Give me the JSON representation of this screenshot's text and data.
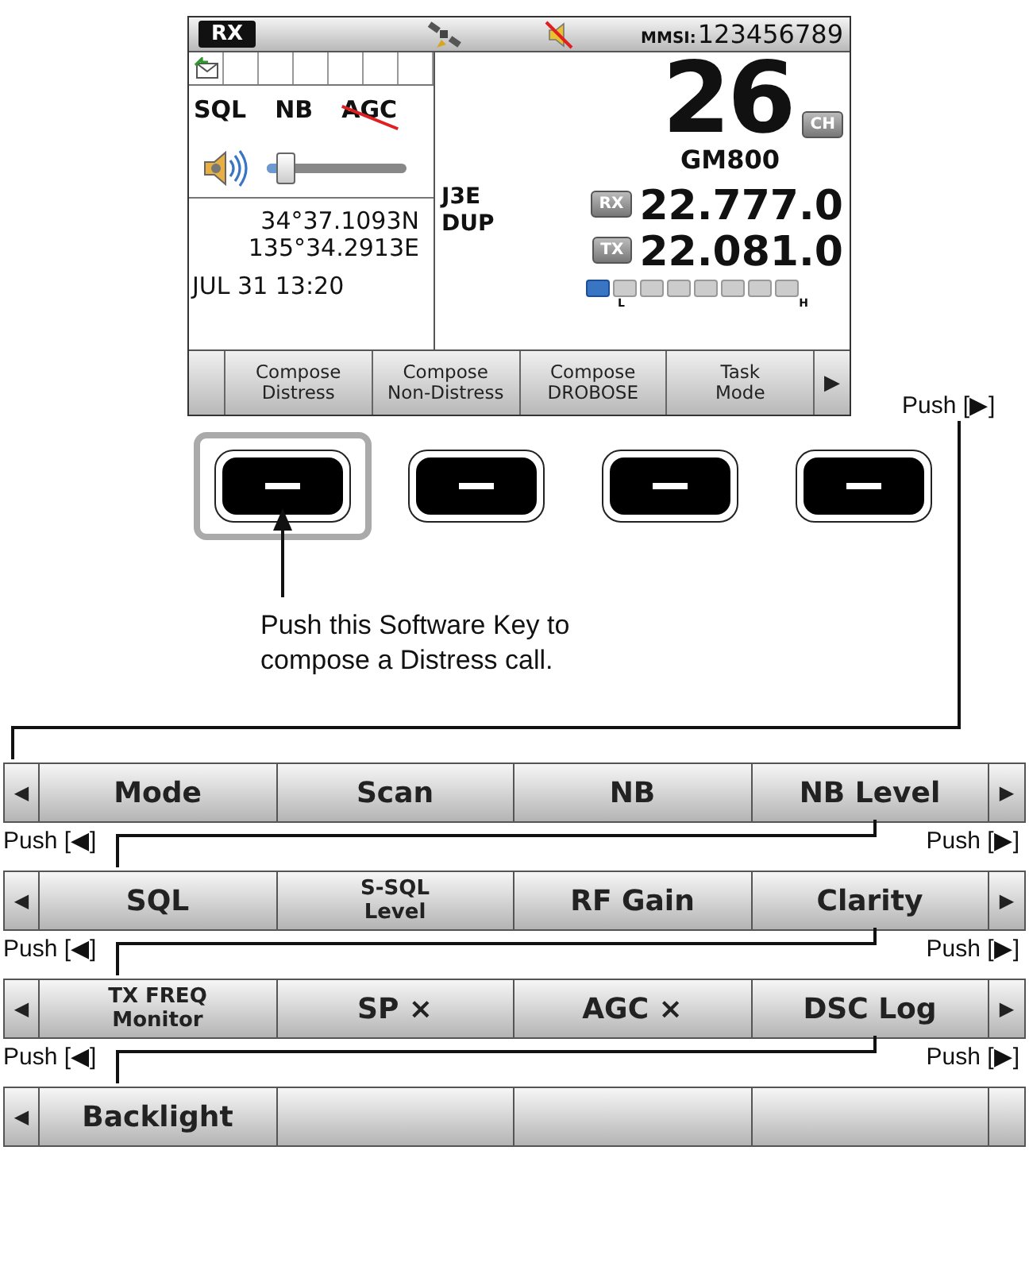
{
  "screen": {
    "status_bar": {
      "mode": "RX",
      "mmsi_label": "MMSI:",
      "mmsi": "123456789"
    },
    "indicators": [
      {
        "label": "SQL",
        "crossed": false
      },
      {
        "label": "NB",
        "crossed": false
      },
      {
        "label": "AGC",
        "crossed": true
      }
    ],
    "volume": {
      "level": 0.12
    },
    "position": [
      "34°37.1093N",
      "135°34.2913E"
    ],
    "datetime": "JUL 31 13:20",
    "channel": "26",
    "channel_badge": "CH",
    "channel_name": "GM800",
    "mode_lines": [
      "J3E",
      "DUP"
    ],
    "frequencies": [
      {
        "badge": "RX",
        "value": "22.777.0"
      },
      {
        "badge": "TX",
        "value": "22.081.0"
      }
    ],
    "power_meter": {
      "level": 0.125,
      "low_label": "L",
      "high_label": "H"
    },
    "soft_keys": [
      "Compose\nDistress",
      "Compose\nNon-Distress",
      "Compose\nDROBOSE",
      "Task\nMode"
    ],
    "more_arrow": "▶"
  },
  "push_right_label": "Push [▶]",
  "hardware_keys": [
    {
      "selected": true
    },
    {
      "selected": false
    },
    {
      "selected": false
    },
    {
      "selected": false
    }
  ],
  "caption": "Push this Software Key to\ncompose a Distress call.",
  "key_bars": [
    {
      "left_arrow": "◀",
      "keys": [
        "Mode",
        "Scan",
        "NB",
        "NB Level"
      ],
      "right_arrow": "▶"
    },
    {
      "left_arrow": "◀",
      "keys": [
        "SQL",
        "S-SQL\nLevel",
        "RF Gain",
        "Clarity"
      ],
      "right_arrow": "▶"
    },
    {
      "left_arrow": "◀",
      "keys": [
        "TX FREQ\nMonitor",
        "SP ×",
        "AGC ×",
        "DSC Log"
      ],
      "right_arrow": "▶"
    },
    {
      "left_arrow": "◀",
      "keys": [
        "Backlight"
      ]
    }
  ],
  "transitions": [
    {
      "left": "Push [◀]",
      "right": "Push [▶]"
    },
    {
      "left": "Push [◀]",
      "right": "Push [▶]"
    },
    {
      "left": "Push [◀]",
      "right": "Push [▶]"
    }
  ]
}
